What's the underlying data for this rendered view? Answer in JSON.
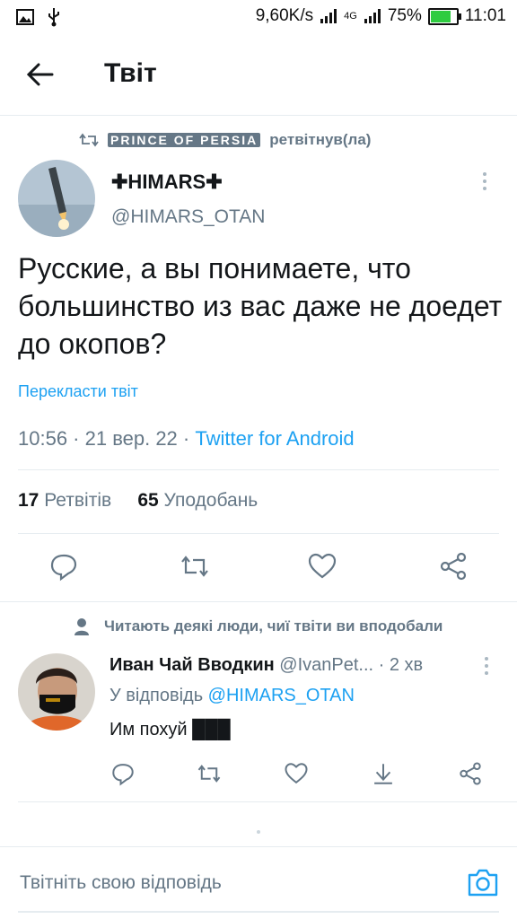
{
  "status_bar": {
    "speed": "9,60K/s",
    "network": "4G",
    "battery": "75%",
    "battery_level": 0.75,
    "time": "11:01"
  },
  "header": {
    "title": "Твіт"
  },
  "retweet": {
    "name": "PRINCE OF PERSIA",
    "suffix": "ретвітнув(ла)"
  },
  "tweet": {
    "name": "✚HIMARS✚",
    "handle": "@HIMARS_OTAN",
    "text": "Русские, а вы понимаете, что большинство из вас даже не доедет до окопов?",
    "translate": "Перекласти твіт",
    "time": "10:56 · 21 вер. 22 · ",
    "source": "Twitter for Android",
    "retweets_count": "17",
    "retweets_label": "Ретвітів",
    "likes_count": "65",
    "likes_label": "Уподобань"
  },
  "reply": {
    "context": "Читають деякі люди, чиї твіти ви вподобали",
    "name": "Иван Чай Вводкин",
    "handle": "@IvanPet...",
    "age": "· 2 хв",
    "replying_prefix": "У відповідь ",
    "replying_to": "@HIMARS_OTAN",
    "text": "Им похуй ███"
  },
  "compose": {
    "placeholder": "Твітніть свою відповідь"
  },
  "icons": [
    "back-arrow-icon",
    "retweet-icon",
    "person-icon",
    "reply-icon",
    "like-icon",
    "share-icon",
    "download-icon",
    "camera-icon",
    "more-icon"
  ],
  "colors": {
    "accent": "#1da1f2",
    "muted": "#657786",
    "battery": "#2ecc40"
  }
}
